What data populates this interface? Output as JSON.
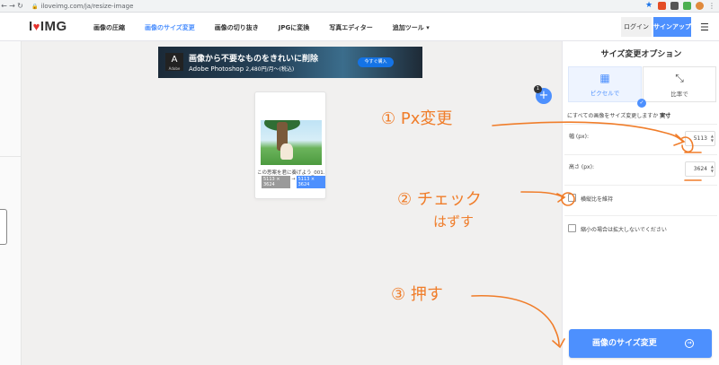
{
  "browser": {
    "url": "iloveimg.com/ja/resize-image"
  },
  "header": {
    "logo_i": "I",
    "logo_text": "IMG",
    "nav": [
      "画像の圧縮",
      "画像のサイズ変更",
      "画像の切り抜き",
      "JPGに変換",
      "写真エディター",
      "追加ツール ▾"
    ],
    "login": "ログイン",
    "signup": "サインアップ"
  },
  "ad": {
    "brand_small": "Adobe",
    "title": "画像から不要なものをきれいに削除",
    "product": "Adobe Photoshop",
    "price": "2,480円/月～(税込)",
    "button": "今すぐ購入"
  },
  "file": {
    "name": "この思案を君に奏げよう_001.png",
    "original_dims": "5113 × 3624",
    "new_dims": "5113 × 3624"
  },
  "add_badge": "1",
  "panel": {
    "title": "サイズ変更オプション",
    "tab_pixel": "ピクセルで",
    "tab_percent": "比率で",
    "subtitle": "にすべての画像をサイズ変更しますか",
    "subtitle_value": "実寸",
    "width_label": "幅 (px):",
    "width_value": "5113",
    "height_label": "高さ (px):",
    "height_value": "3624",
    "keep_ratio": "横縦比を維持",
    "no_enlarge": "縮小の場合は拡大しないでください",
    "action": "画像のサイズ変更"
  },
  "annotations": {
    "step1": "① Px変更",
    "step2": "② チェック",
    "step2b": "はずす",
    "step3": "③ 押す"
  },
  "colors": {
    "accent": "#4d90fe",
    "annotation": "#f07d2a",
    "logo_red": "#e5322d"
  }
}
